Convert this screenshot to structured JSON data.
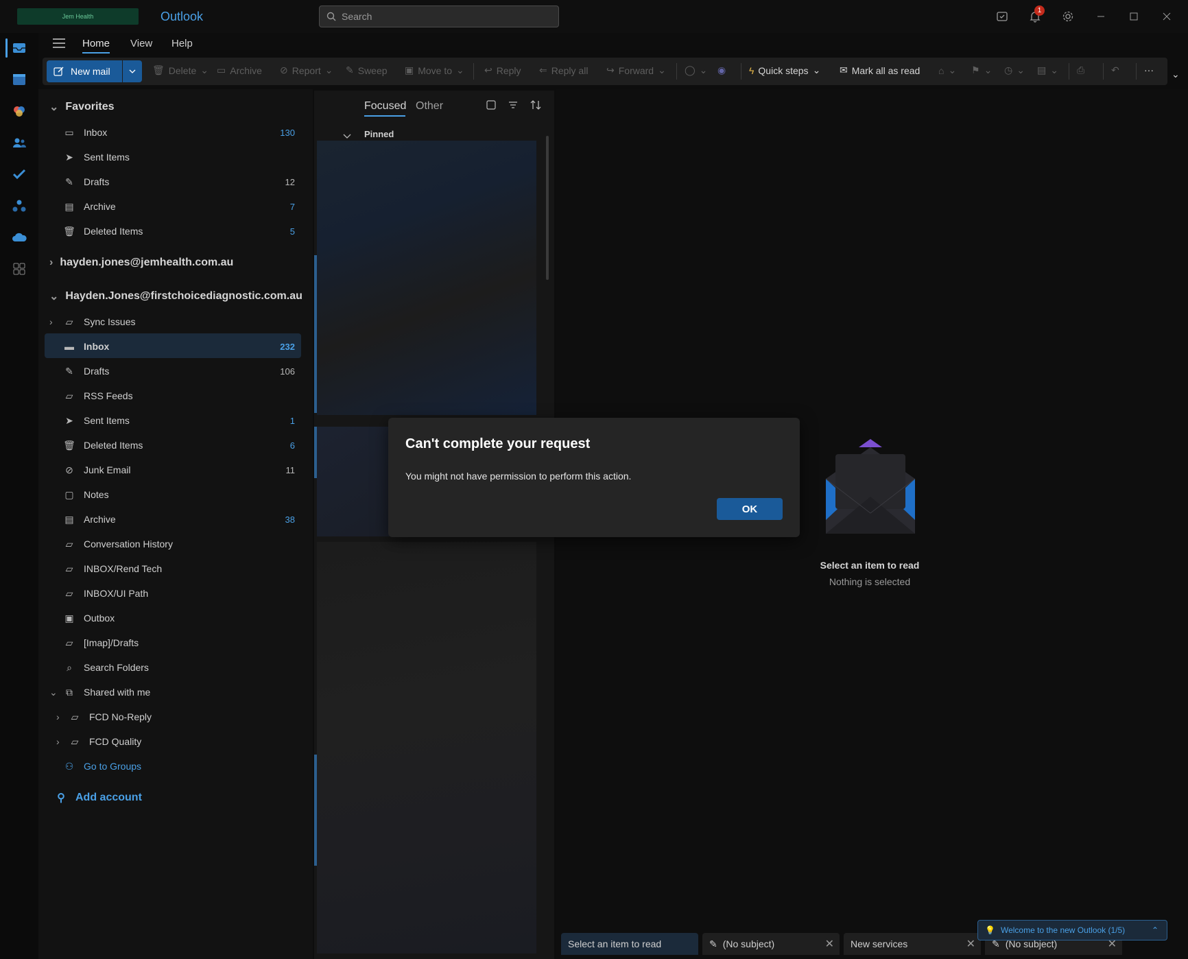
{
  "titlebar": {
    "logo_text": "Jem Health",
    "app_name": "Outlook",
    "search_placeholder": "Search",
    "notification_count": "1"
  },
  "ribbon": {
    "tabs": [
      "Home",
      "View",
      "Help"
    ],
    "new_mail": "New mail",
    "delete": "Delete",
    "archive": "Archive",
    "report": "Report",
    "sweep": "Sweep",
    "move_to": "Move to",
    "reply": "Reply",
    "reply_all": "Reply all",
    "forward": "Forward",
    "quick_steps": "Quick steps",
    "mark_all_read": "Mark all as read"
  },
  "favorites": {
    "header": "Favorites",
    "items": [
      {
        "label": "Inbox",
        "count": "130"
      },
      {
        "label": "Sent Items",
        "count": ""
      },
      {
        "label": "Drafts",
        "count": "12"
      },
      {
        "label": "Archive",
        "count": "7"
      },
      {
        "label": "Deleted Items",
        "count": "5"
      }
    ]
  },
  "account1": {
    "email": "hayden.jones@jemhealth.com.au"
  },
  "account2": {
    "email": "Hayden.Jones@firstchoicediagnostic.com.au",
    "folders": [
      {
        "label": "Sync Issues",
        "count": ""
      },
      {
        "label": "Inbox",
        "count": "232"
      },
      {
        "label": "Drafts",
        "count": "106"
      },
      {
        "label": "RSS Feeds",
        "count": ""
      },
      {
        "label": "Sent Items",
        "count": "1"
      },
      {
        "label": "Deleted Items",
        "count": "6"
      },
      {
        "label": "Junk Email",
        "count": "11"
      },
      {
        "label": "Notes",
        "count": ""
      },
      {
        "label": "Archive",
        "count": "38"
      },
      {
        "label": "Conversation History",
        "count": ""
      },
      {
        "label": "INBOX/Rend Tech",
        "count": ""
      },
      {
        "label": "INBOX/UI Path",
        "count": ""
      },
      {
        "label": "Outbox",
        "count": ""
      },
      {
        "label": "[Imap]/Drafts",
        "count": ""
      },
      {
        "label": "Search Folders",
        "count": ""
      }
    ],
    "shared_header": "Shared with me",
    "shared": [
      {
        "label": "FCD No-Reply"
      },
      {
        "label": "FCD Quality"
      }
    ],
    "go_to_groups": "Go to Groups"
  },
  "add_account": "Add account",
  "message_list": {
    "tab_focused": "Focused",
    "tab_other": "Other",
    "pinned": "Pinned"
  },
  "reading_pane": {
    "empty_title": "Select an item to read",
    "empty_subtitle": "Nothing is selected"
  },
  "dialog": {
    "title": "Can't complete your request",
    "message": "You might not have permission to perform this action.",
    "ok": "OK"
  },
  "bottom_tabs": [
    {
      "label": "Select an item to read"
    },
    {
      "label": "(No subject)"
    },
    {
      "label": "New services"
    },
    {
      "label": "(No subject)"
    }
  ],
  "welcome": "Welcome to the new Outlook  (1/5)",
  "colors": {
    "accent": "#4aa0e6",
    "primary_button": "#1a5a99",
    "badge": "#c42b1c"
  }
}
